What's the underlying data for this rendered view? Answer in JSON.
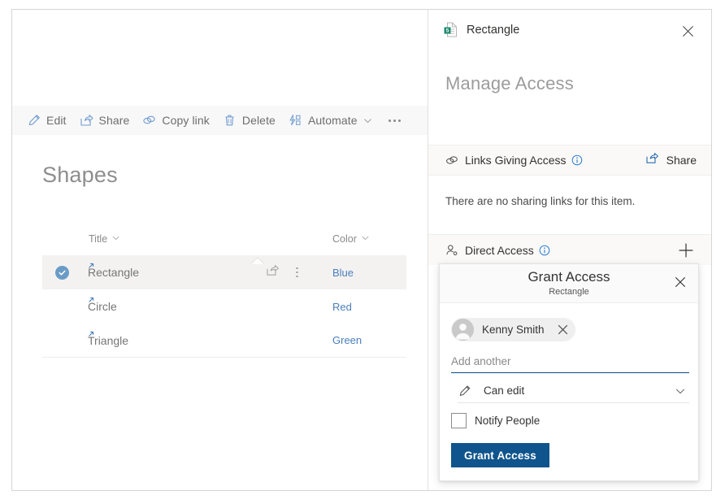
{
  "commandbar": {
    "items": [
      {
        "label": "Edit",
        "icon": "pencil-icon"
      },
      {
        "label": "Share",
        "icon": "share-icon"
      },
      {
        "label": "Copy link",
        "icon": "link-icon"
      },
      {
        "label": "Delete",
        "icon": "trash-icon"
      },
      {
        "label": "Automate",
        "icon": "automate-icon",
        "chevron": true
      }
    ],
    "overflow": "more-options-icon"
  },
  "list": {
    "title": "Shapes",
    "columns": [
      {
        "label": "Title"
      },
      {
        "label": "Color"
      }
    ],
    "rows": [
      {
        "title": "Rectangle",
        "color": "Blue",
        "selected": true
      },
      {
        "title": "Circle",
        "color": "Red",
        "selected": false
      },
      {
        "title": "Triangle",
        "color": "Green",
        "selected": false
      }
    ]
  },
  "panel": {
    "title": "Rectangle",
    "icon": "list-item-icon",
    "close": "close-icon",
    "heading": "Manage Access",
    "links_section": {
      "label": "Links Giving Access",
      "icon": "link-icon",
      "info": "info-icon",
      "action_label": "Share",
      "action_icon": "share-icon",
      "empty_text": "There are no sharing links for this item."
    },
    "direct_section": {
      "label": "Direct Access",
      "icon": "people-icon",
      "info": "info-icon",
      "add_icon": "plus-icon"
    }
  },
  "grant_access": {
    "title": "Grant Access",
    "subtitle": "Rectangle",
    "close": "close-icon",
    "person": {
      "name": "Kenny Smith",
      "avatar": "person-avatar",
      "remove": "remove-icon"
    },
    "add_another_placeholder": "Add another",
    "permission": {
      "value": "Can edit",
      "icon": "pencil-icon",
      "chevron": "chevron-down-icon"
    },
    "notify_label": "Notify People",
    "notify_checked": false,
    "submit_label": "Grant Access"
  },
  "colors": {
    "accent_blue": "#0f548c",
    "link_blue": "#4a7ebb",
    "selection_blue": "#6b9bc7",
    "selected_row_bg": "#f3f2f1",
    "command_bar_bg": "#f8f8f8",
    "section_bg": "#faf9f8"
  }
}
